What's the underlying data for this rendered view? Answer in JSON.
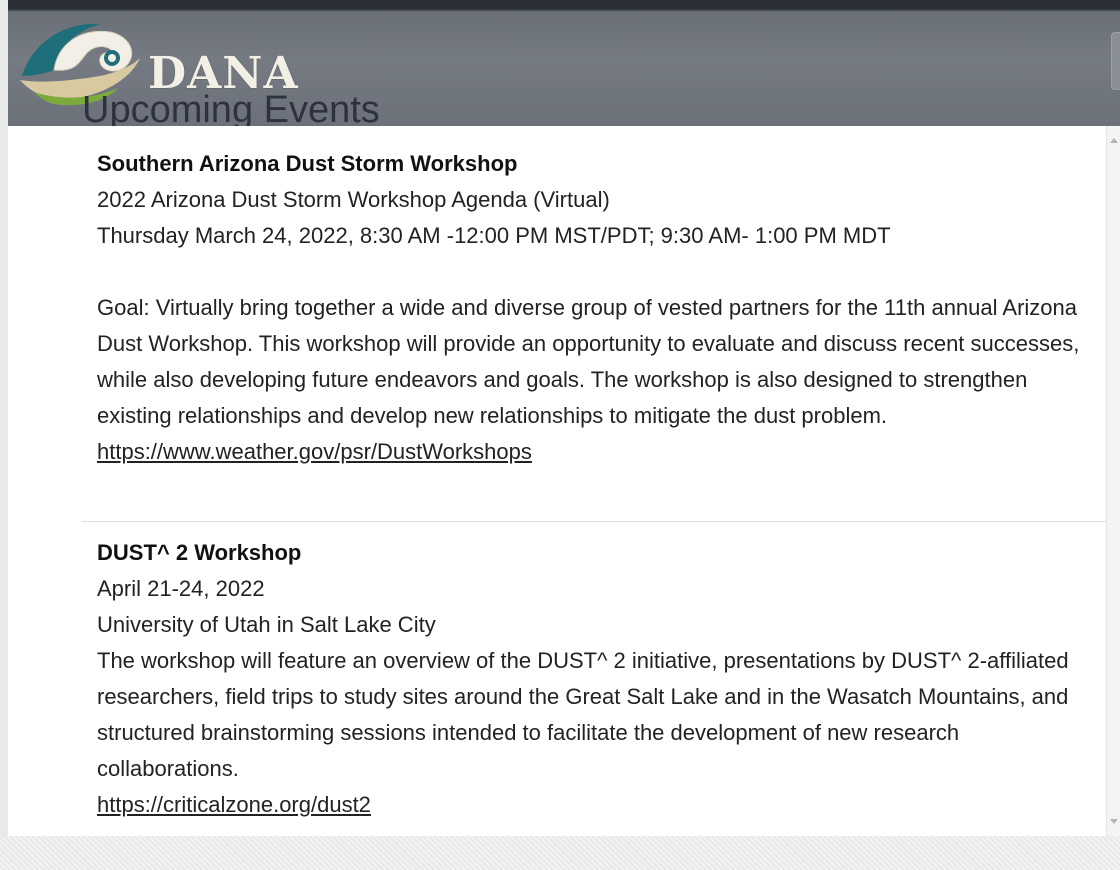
{
  "header": {
    "logo_text": "DANA",
    "page_title": "Upcoming Events"
  },
  "colors": {
    "header_bg": "#757a83",
    "header_top_bar": "#2b3038",
    "logo_teal": "#1f6f7a",
    "logo_green": "#7cab3c",
    "logo_cream": "#f2efe6"
  },
  "events": [
    {
      "title": "Southern Arizona Dust Storm Workshop",
      "subtitle": "2022 Arizona Dust Storm Workshop Agenda (Virtual)",
      "date": "Thursday March 24, 2022, 8:30 AM -12:00 PM MST/PDT; 9:30 AM- 1:00 PM MDT",
      "description": "Goal: Virtually bring together a wide and diverse group of vested partners for the 11th annual Arizona Dust Workshop. This workshop will provide an opportunity to evaluate and discuss recent successes, while also developing future endeavors and goals. The workshop is also designed to strengthen existing relationships and develop new relationships to mitigate the dust problem.",
      "link": "https://www.weather.gov/psr/DustWorkshops"
    },
    {
      "title": "DUST^ 2 Workshop",
      "date": "April 21-24, 2022",
      "location": "University of Utah in Salt Lake City",
      "description": "The workshop will feature an overview of the DUST^ 2 initiative, presentations by DUST^ 2-affiliated researchers, field trips to study sites around the Great Salt Lake and in the Wasatch Mountains, and structured brainstorming sessions intended to facilitate the development of new research collaborations.",
      "link": "https://criticalzone.org/dust2"
    }
  ]
}
